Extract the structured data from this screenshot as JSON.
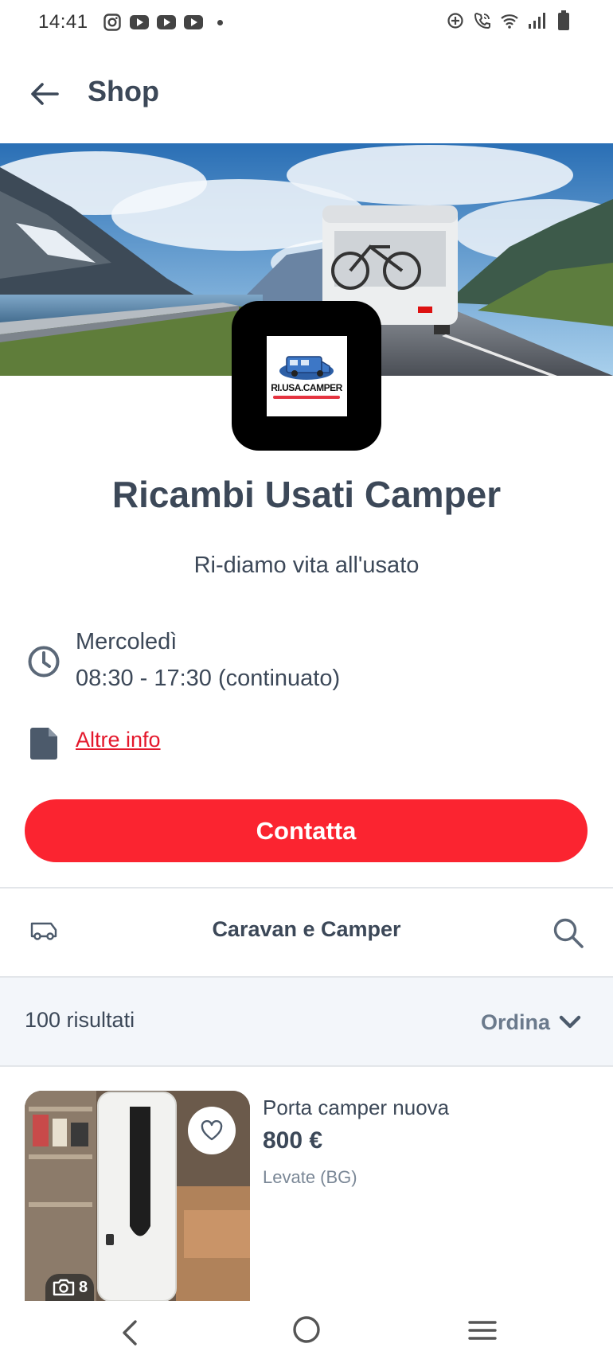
{
  "status_bar": {
    "time": "14:41",
    "left_icons": [
      "instagram-icon",
      "youtube-icon",
      "youtube-icon",
      "youtube-icon",
      "notification-dot-icon"
    ],
    "right_icons": [
      "data-saver-icon",
      "wifi-calling-icon",
      "wifi-icon",
      "signal-icon",
      "battery-icon"
    ]
  },
  "header": {
    "title": "Shop",
    "back_icon": "arrow-left-icon"
  },
  "shop": {
    "logo_text": "RI.USA.CAMPER",
    "name": "Ricambi Usati Camper",
    "tagline": "Ri-diamo vita all'usato",
    "hours": {
      "day": "Mercoledì",
      "time": "08:30 - 17:30 (continuato)"
    },
    "more_info_label": "Altre info",
    "contact_label": "Contatta"
  },
  "category": {
    "label": "Caravan e Camper",
    "icon": "camper-van-icon",
    "search_icon": "search-icon"
  },
  "results": {
    "count_label": "100 risultati",
    "sort_label": "Ordina"
  },
  "listings": [
    {
      "title": "Porta camper nuova",
      "price": "800 €",
      "location": "Levate (BG)",
      "photo_count": "8"
    }
  ],
  "colors": {
    "accent": "#fb2430",
    "link": "#e4182c",
    "text": "#3c4858",
    "results_bg": "#f3f6fa"
  },
  "nav_bar": {
    "icons": [
      "system-back-icon",
      "system-home-icon",
      "system-recents-icon"
    ]
  }
}
